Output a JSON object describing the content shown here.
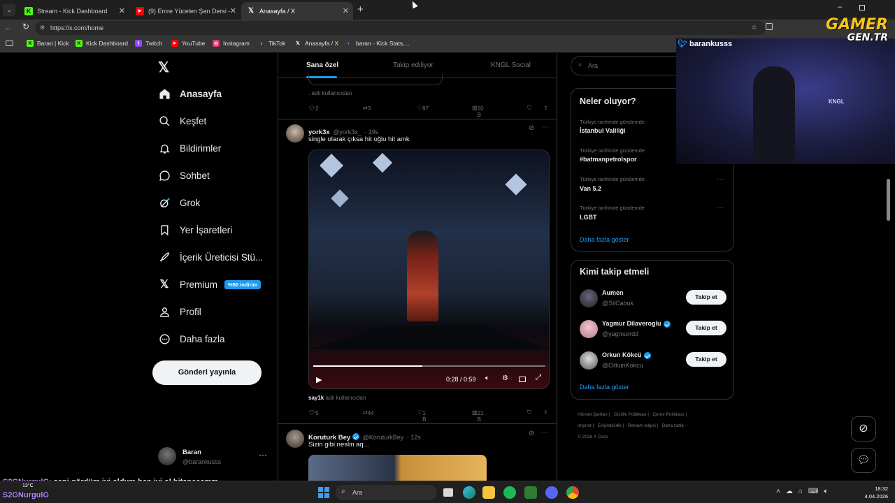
{
  "browser": {
    "tabs": [
      {
        "title": "Stream - Kick Dashboard",
        "icon": "kick-icon"
      },
      {
        "title": "(9) Emre Yücelen Şan Dersi - YouTu",
        "icon": "youtube-icon"
      },
      {
        "title": "Anasayfa / X",
        "icon": "x-icon"
      }
    ],
    "url": "https://x.com/home",
    "bookmarks": [
      {
        "label": "Baran | Kick",
        "color": "#53fc18"
      },
      {
        "label": "Kick Dashboard",
        "color": "#53fc18"
      },
      {
        "label": "Twitch",
        "color": "#9146ff"
      },
      {
        "label": "YouTube",
        "color": "#ff0000"
      },
      {
        "label": "Instagram",
        "color": "#e1306c"
      },
      {
        "label": "TikTok",
        "color": "#ffffff"
      },
      {
        "label": "Anasayfa / X",
        "color": "#ffffff"
      },
      {
        "label": "baran - Kick Stats,...",
        "color": "#6a8cff"
      }
    ]
  },
  "nav": {
    "items": [
      {
        "label": "Anasayfa",
        "icon": "home-icon"
      },
      {
        "label": "Keşfet",
        "icon": "search-icon"
      },
      {
        "label": "Bildirimler",
        "icon": "bell-icon"
      },
      {
        "label": "Sohbet",
        "icon": "chat-icon"
      },
      {
        "label": "Grok",
        "icon": "grok-icon"
      },
      {
        "label": "Yer İşaretleri",
        "icon": "bookmark-icon"
      },
      {
        "label": "İçerik Üreticisi Stü...",
        "icon": "rocket-icon"
      },
      {
        "label": "Premium",
        "icon": "x-premium-icon"
      },
      {
        "label": "Profil",
        "icon": "person-icon"
      },
      {
        "label": "Daha fazla",
        "icon": "more-circle-icon"
      }
    ],
    "premium_badge": "%50 indirim",
    "post_button": "Gönderi yayınla",
    "account": {
      "name": "Baran",
      "handle": "@barankusss"
    }
  },
  "main": {
    "tabs": [
      "Sana özel",
      "Takip ediliyor",
      "KNGL Social"
    ],
    "prev_tweet": {
      "footer": "adlı kullanıcıdan",
      "replies": "2",
      "retweets": "3",
      "likes": "97",
      "views": "10 B"
    },
    "tweet1": {
      "name": "york3x",
      "handle": "@york3x_",
      "time": "· 19s",
      "text": "single olarak çıksa hit oğlu hit amk",
      "video_time": "0:28 / 0:59",
      "video_progress": 0.47,
      "footer_user": "say1k",
      "footer_text": "adlı kullanıcıdan",
      "replies": "5",
      "retweets": "44",
      "likes": "1 B",
      "views": "21 B"
    },
    "tweet2": {
      "name": "Koruturk Bey",
      "handle": "@KoruturkBey",
      "time": "· 12s",
      "text": "Sizin gibi neslin aq..."
    }
  },
  "right": {
    "search_placeholder": "Ara",
    "trends_title": "Neler oluyor?",
    "trends": [
      {
        "context": "Türkiye tarihinde gündemde",
        "name": "İstanbul Valiliği"
      },
      {
        "context": "Türkiye tarihinde gündemde",
        "name": "#batmanpetrolspor"
      },
      {
        "context": "Türkiye tarihinde gündemde",
        "name": "Van 5.2"
      },
      {
        "context": "Türkiye tarihinde gündemde",
        "name": "LGBT"
      }
    ],
    "show_more": "Daha fazla göster",
    "follow_title": "Kimi takip etmeli",
    "follow": [
      {
        "name": "Aumen",
        "handle": "@SilCabuk",
        "verified": false
      },
      {
        "name": "Yagmur Dilaveroglu",
        "handle": "@yagmurrdd",
        "verified": true
      },
      {
        "name": "Orkun Kökcü",
        "handle": "@OrkunKokcu",
        "verified": true
      }
    ],
    "follow_button": "Takip et",
    "footer_links": [
      "Hizmet Şartları",
      "Gizlilik Politikası",
      "Çerez Politikası",
      "Imprint",
      "Erişilebilirlik",
      "Reklam bilgisi",
      "Daha fazla ···"
    ],
    "copyright": "© 2026 X Corp."
  },
  "overlay": {
    "webcam_user": "barankusss",
    "brand_top": "GAMER",
    "brand_bottom": "GEN.TR",
    "chat_user": "S2GNurgulG",
    "chat_text": ": seni gördüm iyi oldum hep iyi ol bitaneeemm",
    "chat_user2": "S2GNurgulG"
  },
  "taskbar": {
    "weather": "13°C",
    "search": "Ara",
    "time": "18:32",
    "date": "4.04.2026"
  }
}
